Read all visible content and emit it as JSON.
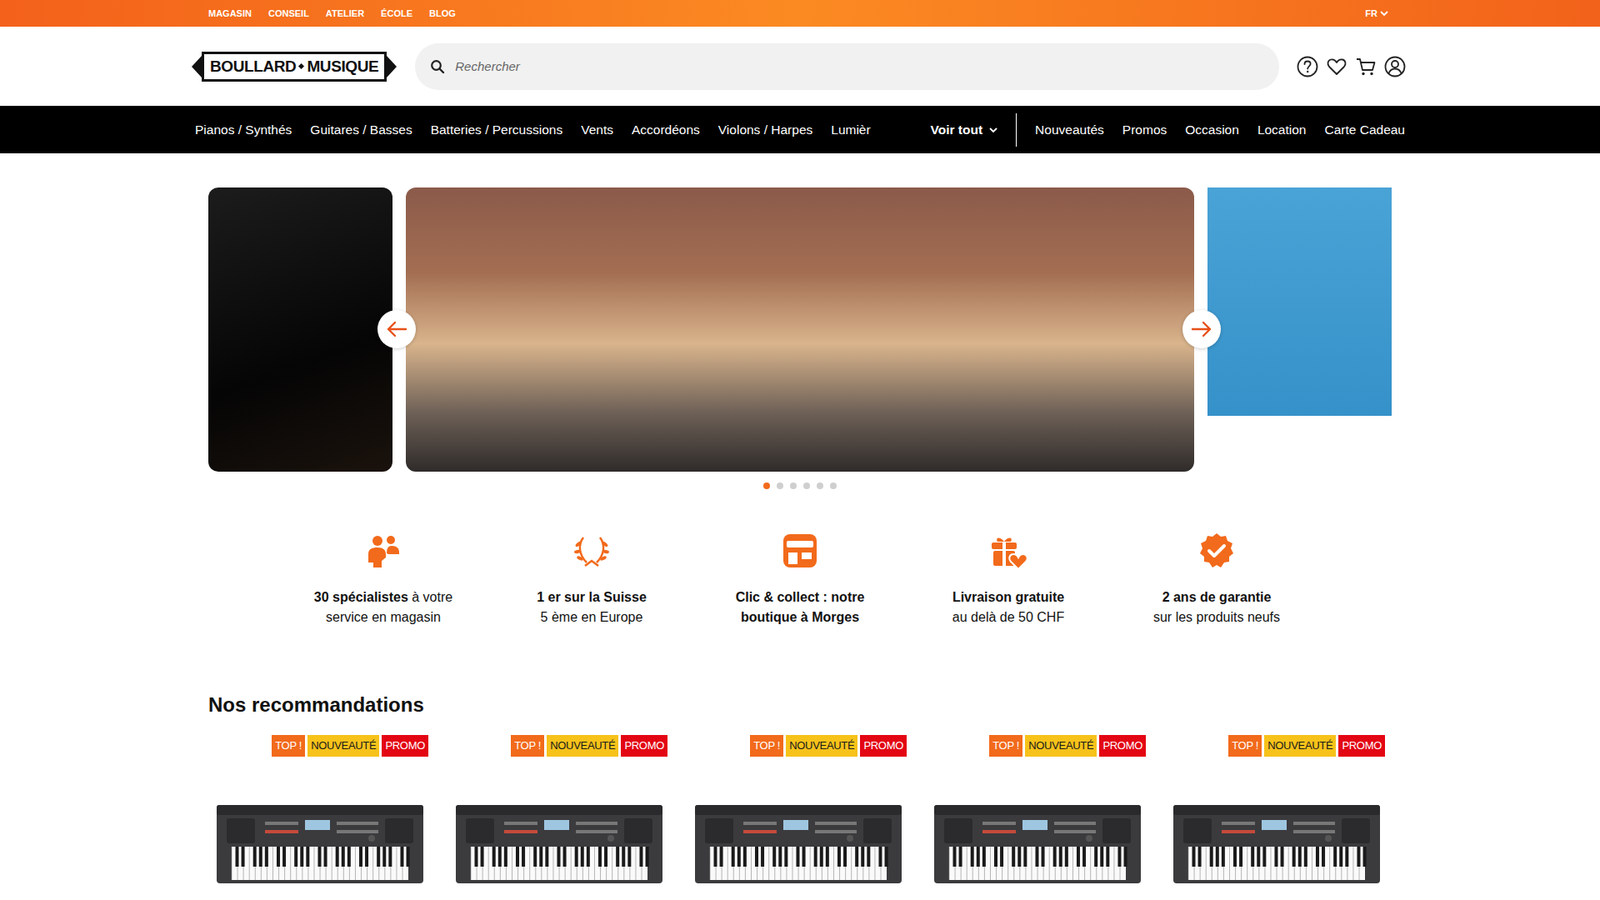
{
  "top_bar": {
    "links": [
      "MAGASIN",
      "CONSEIL",
      "ATELIER",
      "ÉCOLE",
      "BLOG"
    ],
    "language": "FR"
  },
  "header": {
    "logo": {
      "left": "BOULLARD",
      "right": "MUSIQUE"
    },
    "search": {
      "placeholder": "Rechercher"
    }
  },
  "nav": {
    "categories": [
      "Pianos / Synthés",
      "Guitares / Basses",
      "Batteries / Percussions",
      "Vents",
      "Accordéons",
      "Violons / Harpes",
      "Lumièr"
    ],
    "more": "Voir tout",
    "links": [
      "Nouveautés",
      "Promos",
      "Occasion",
      "Location",
      "Carte Cadeau"
    ]
  },
  "carousel": {
    "dots": [
      {
        "selected": true
      },
      {
        "selected": false
      },
      {
        "selected": false
      },
      {
        "selected": false
      },
      {
        "selected": false
      },
      {
        "selected": false
      }
    ]
  },
  "features": [
    {
      "bold": "30 spécialistes",
      "text": " à votre service en magasin",
      "kind": "inline"
    },
    {
      "bold": "1 er sur la Suisse",
      "text": "5 ème en Europe",
      "kind": "stacked"
    },
    {
      "bold": "Clic & collect : notre boutique à Morges",
      "kind": "inline"
    },
    {
      "bold": "Livraison gratuite",
      "text": "au delà de 50 CHF",
      "kind": "stacked"
    },
    {
      "bold": "2 ans de garantie",
      "text": "sur les produits neufs",
      "kind": "stacked"
    }
  ],
  "recommendations": {
    "title": "Nos recommandations",
    "products": [
      {
        "badges": [
          {
            "label": "TOP !",
            "color": "#f26a1b"
          },
          {
            "label": "NOUVEAUTÉ",
            "color": "#f7c21a"
          },
          {
            "label": "PROMO",
            "color": "#e30613"
          }
        ]
      },
      {
        "badges": [
          {
            "label": "TOP !",
            "color": "#f26a1b"
          },
          {
            "label": "NOUVEAUTÉ",
            "color": "#f7c21a"
          },
          {
            "label": "PROMO",
            "color": "#e30613"
          }
        ]
      },
      {
        "badges": [
          {
            "label": "TOP !",
            "color": "#f26a1b"
          },
          {
            "label": "NOUVEAUTÉ",
            "color": "#f7c21a"
          },
          {
            "label": "PROMO",
            "color": "#e30613"
          }
        ]
      },
      {
        "badges": [
          {
            "label": "TOP !",
            "color": "#f26a1b"
          },
          {
            "label": "NOUVEAUTÉ",
            "color": "#f7c21a"
          },
          {
            "label": "PROMO",
            "color": "#e30613"
          }
        ]
      },
      {
        "badges": [
          {
            "label": "TOP !",
            "color": "#f26a1b"
          },
          {
            "label": "NOUVEAUTÉ",
            "color": "#f7c21a"
          },
          {
            "label": "PROMO",
            "color": "#e30613"
          }
        ]
      }
    ]
  }
}
